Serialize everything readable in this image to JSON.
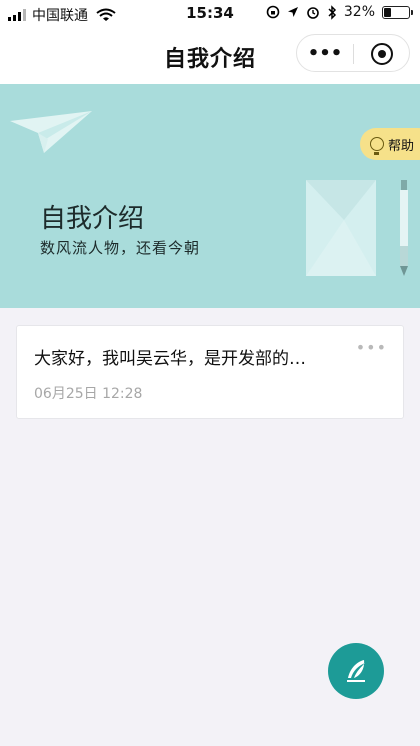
{
  "status_bar": {
    "carrier": "中国联通",
    "time": "15:34",
    "battery": "32%",
    "battery_level": 0.32,
    "icons": [
      "signal-icon",
      "wifi-icon",
      "orientation-lock-icon",
      "location-icon",
      "alarm-icon",
      "bluetooth-icon",
      "battery-icon"
    ]
  },
  "nav": {
    "title": "自我介绍",
    "more_label": "•••",
    "icons": [
      "more-icon",
      "close-target-icon"
    ]
  },
  "banner": {
    "title": "自我介绍",
    "subtitle": "数风流人物，还看今朝",
    "help_label": "帮助",
    "background_color": "#a9dcdb",
    "icons": [
      "paper-plane-icon",
      "lightbulb-icon",
      "envelope-icon",
      "pen-icon"
    ]
  },
  "entries": [
    {
      "text": "大家好，我叫吴云华，是开发部的…",
      "date": "06月25日 12:28",
      "more_label": "•••"
    }
  ],
  "fab": {
    "icon": "quill-pen-icon",
    "color": "#1d9b97"
  }
}
